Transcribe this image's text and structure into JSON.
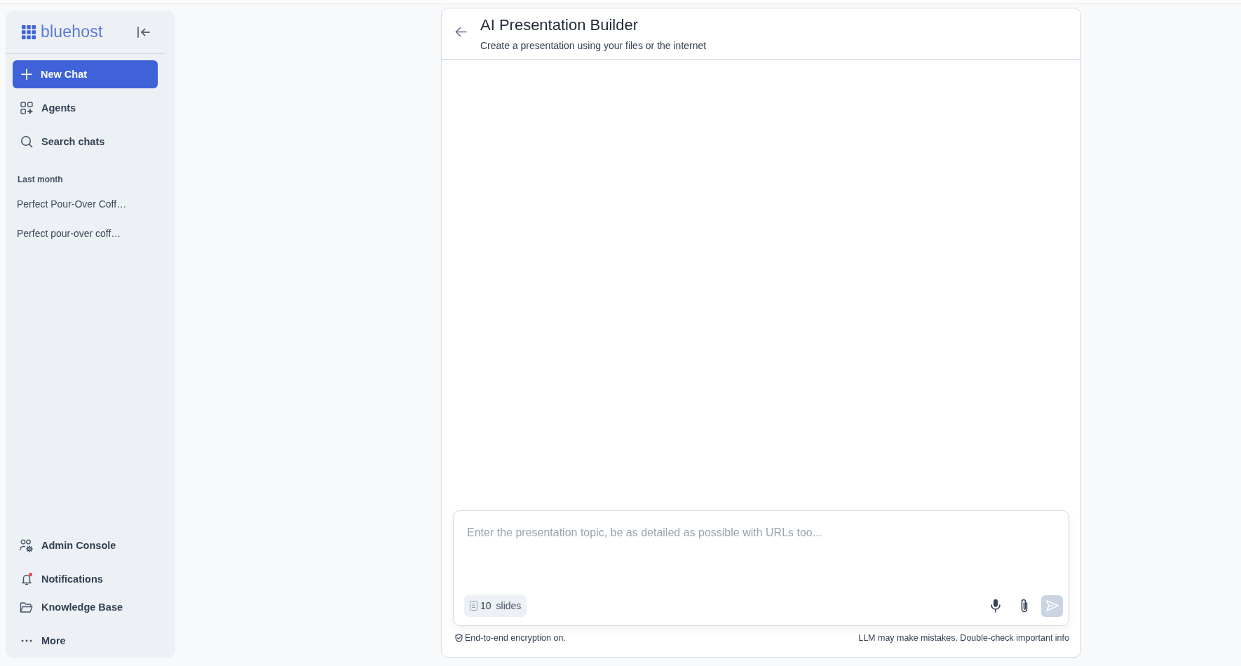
{
  "sidebar": {
    "logo": "bluehost",
    "new_chat_button": "New Chat",
    "nav_items": [
      {
        "label": "Agents"
      },
      {
        "label": "Search chats"
      }
    ],
    "history": {
      "heading": "Last month",
      "items": [
        {
          "label": "Perfect Pour-Over Coff…",
          "selected": false
        },
        {
          "label": "Perfect pour-over coff…",
          "selected": false
        }
      ]
    },
    "bottom_items": [
      {
        "label": "Admin Console",
        "unread": false
      },
      {
        "label": "Notifications",
        "unread": true
      },
      {
        "label": "Knowledge Base",
        "unread": false
      },
      {
        "label": "More",
        "unread": false
      }
    ]
  },
  "builder": {
    "title": "AI Presentation Builder",
    "subtitle": "Create a presentation using your files or the internet",
    "composer": {
      "prompt": {
        "placeholder": "Enter the presentation topic, be as detailed as possible with URLs too..."
      },
      "slides": {
        "count": "10",
        "label": "slides"
      },
      "send_button": {
        "disabled": true
      }
    },
    "footer": {
      "encryption_note": "End-to-end encryption on.",
      "disclaimer": "LLM may make mistakes. Double-check important info"
    }
  }
}
